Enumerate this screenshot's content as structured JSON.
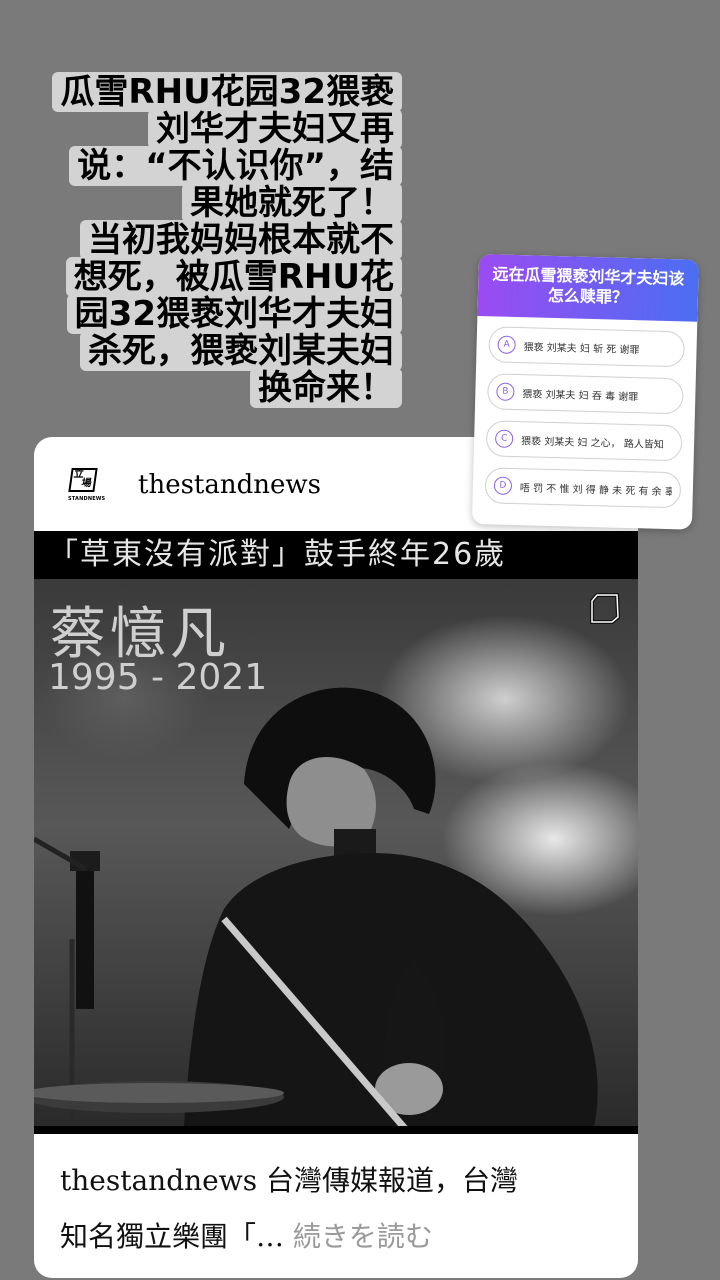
{
  "caption": {
    "lines": [
      "瓜雪RHU花园32猥亵",
      "刘华才夫妇又再",
      "说：“不认识你”，结",
      "果她就死了！",
      "当初我妈妈根本就不",
      "想死，被瓜雪RHU花",
      "园32猥亵刘华才夫妇",
      "杀死，猥亵刘某夫妇",
      "换命来！"
    ]
  },
  "quiz": {
    "question": "远在瓜雪猥亵刘华才夫妇该怎么赎罪？",
    "options": [
      {
        "letter": "A",
        "text": "猥亵 刘某夫 妇 斩 死 谢罪"
      },
      {
        "letter": "B",
        "text": "猥亵 刘某夫 妇 吞 毒 谢罪"
      },
      {
        "letter": "C",
        "text": "猥亵 刘某夫 妇 之心， 路人皆知"
      },
      {
        "letter": "D",
        "text": "唔 罚 不 惟 刘 得 静 未 死 有 余 辜 ?"
      }
    ],
    "colors": {
      "gradient_start": "#9b4bf2",
      "gradient_end": "#4b6ef2"
    }
  },
  "post": {
    "logo_char_1": "立",
    "logo_char_2": "場",
    "logo_wordmark": "STANDNEWS",
    "handle": "thestandnews",
    "media": {
      "banner": "「草東沒有派對」鼓手終年26歲",
      "name": "蔡憶凡",
      "years": "1995 - 2021"
    },
    "caption_line_1": "thestandnews 台灣傳媒報道，台灣",
    "caption_line_2": "知名獨立樂團「…",
    "more_label": "続きを読む"
  }
}
